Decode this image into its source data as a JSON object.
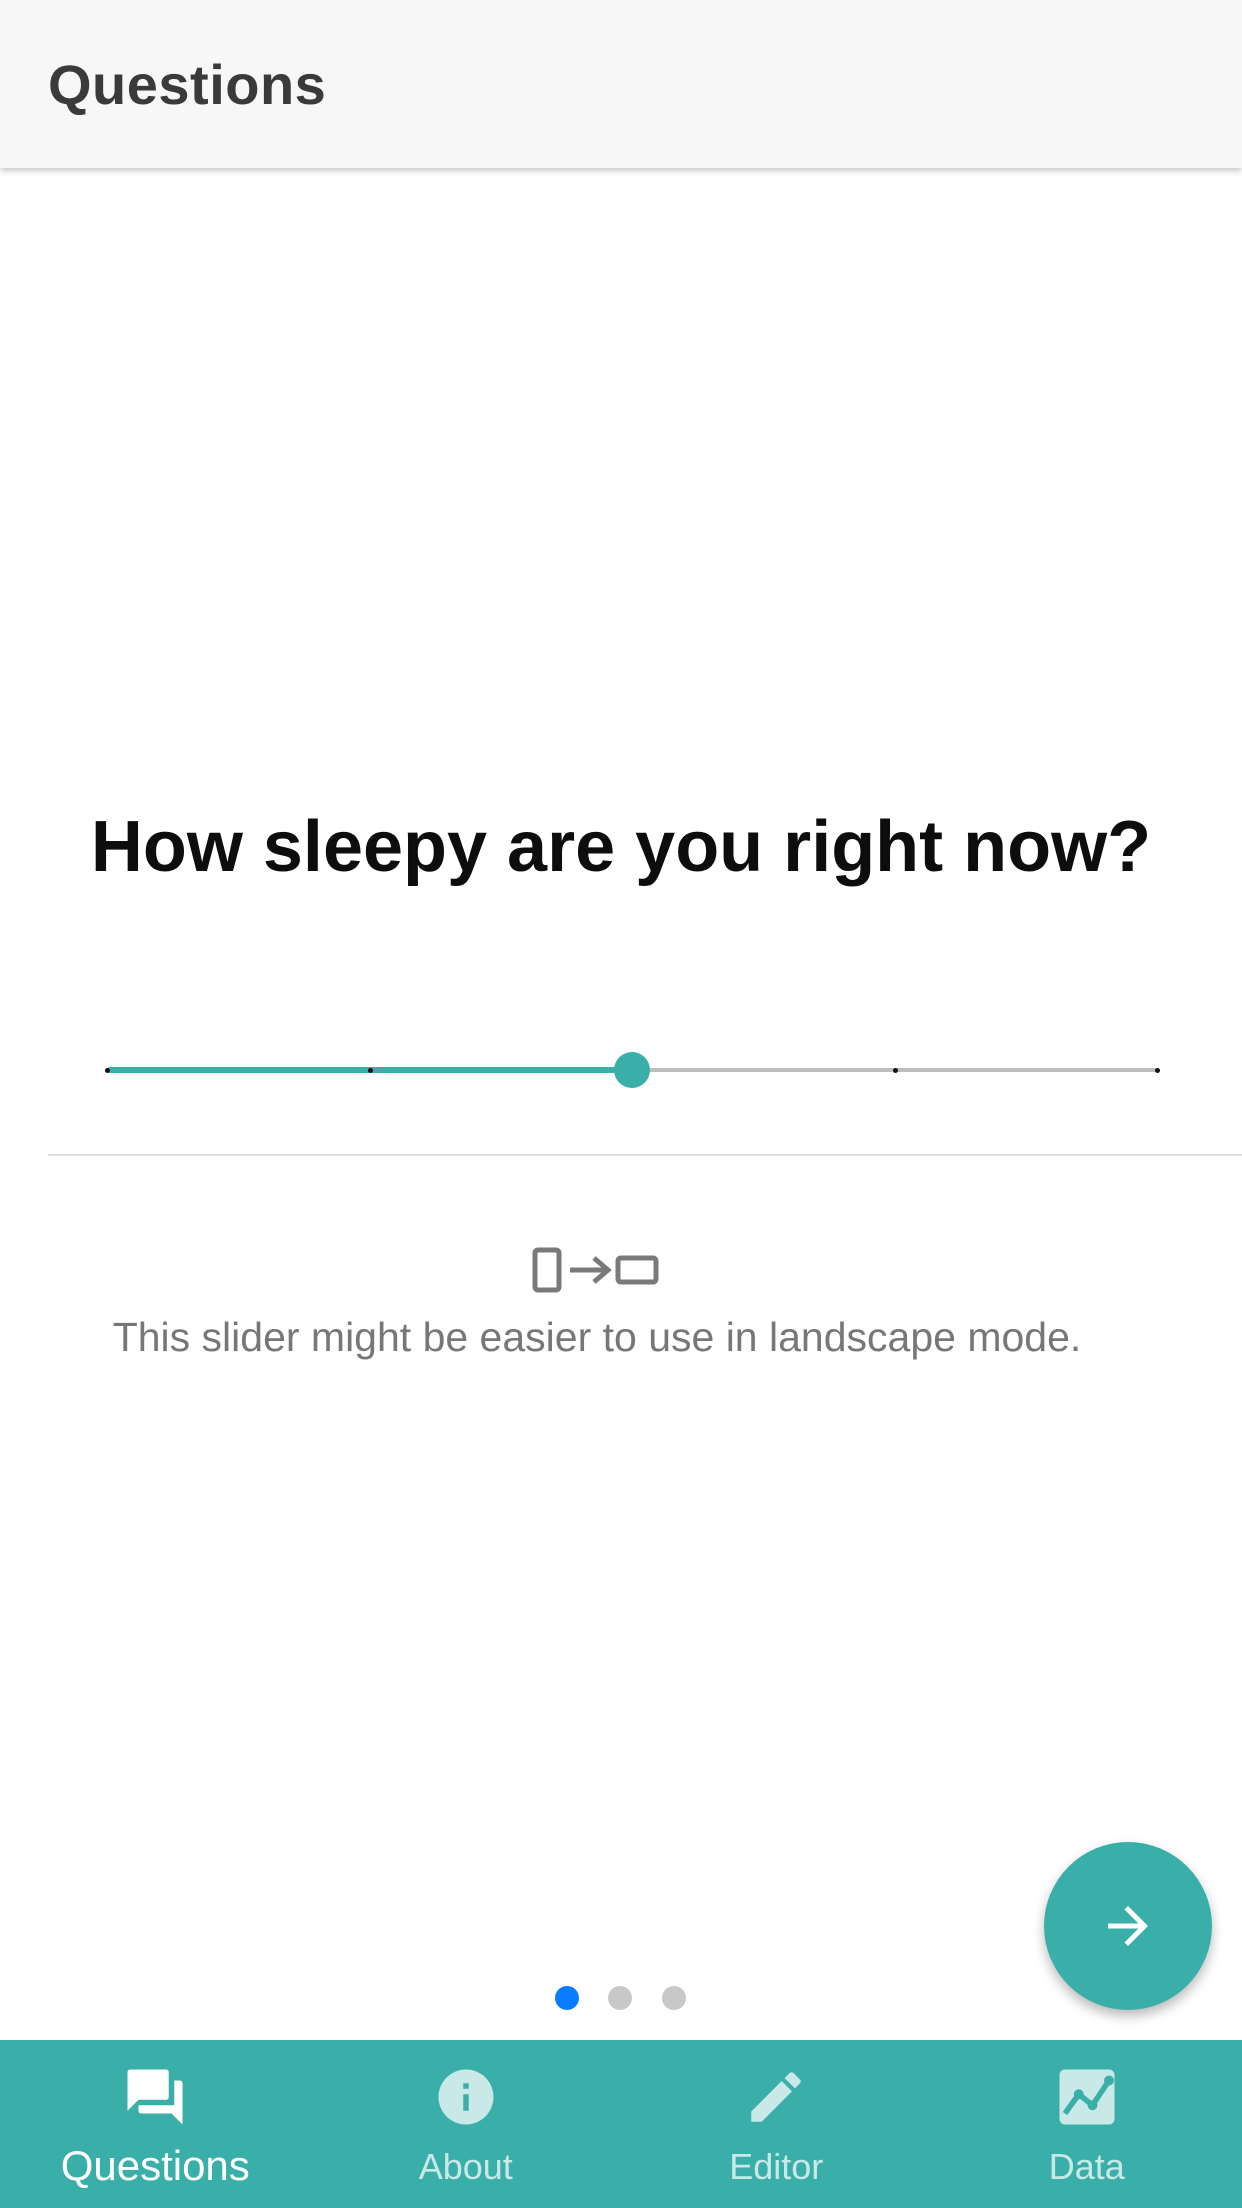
{
  "app_bar": {
    "title": "Questions"
  },
  "question": {
    "text": "How sleepy are you right now?"
  },
  "slider": {
    "ticks": 5,
    "value": 2,
    "min": 0,
    "max": 4,
    "accent_color": "#3aafaa",
    "track_color": "#bdbdbd"
  },
  "hint": {
    "icon": "rotate-to-landscape-icon",
    "text": "This slider might be easier to use in landscape mode."
  },
  "fab": {
    "icon": "arrow-right-icon",
    "color": "#3aafaa"
  },
  "pager": {
    "count": 3,
    "current": 1,
    "active_color": "#0a7cff"
  },
  "bottom_nav": {
    "background": "#3aafaa",
    "items": [
      {
        "label": "Questions",
        "icon": "chat-bubbles-icon",
        "active": true
      },
      {
        "label": "About",
        "icon": "info-icon",
        "active": false
      },
      {
        "label": "Editor",
        "icon": "pencil-icon",
        "active": false
      },
      {
        "label": "Data",
        "icon": "chart-icon",
        "active": false
      }
    ]
  }
}
